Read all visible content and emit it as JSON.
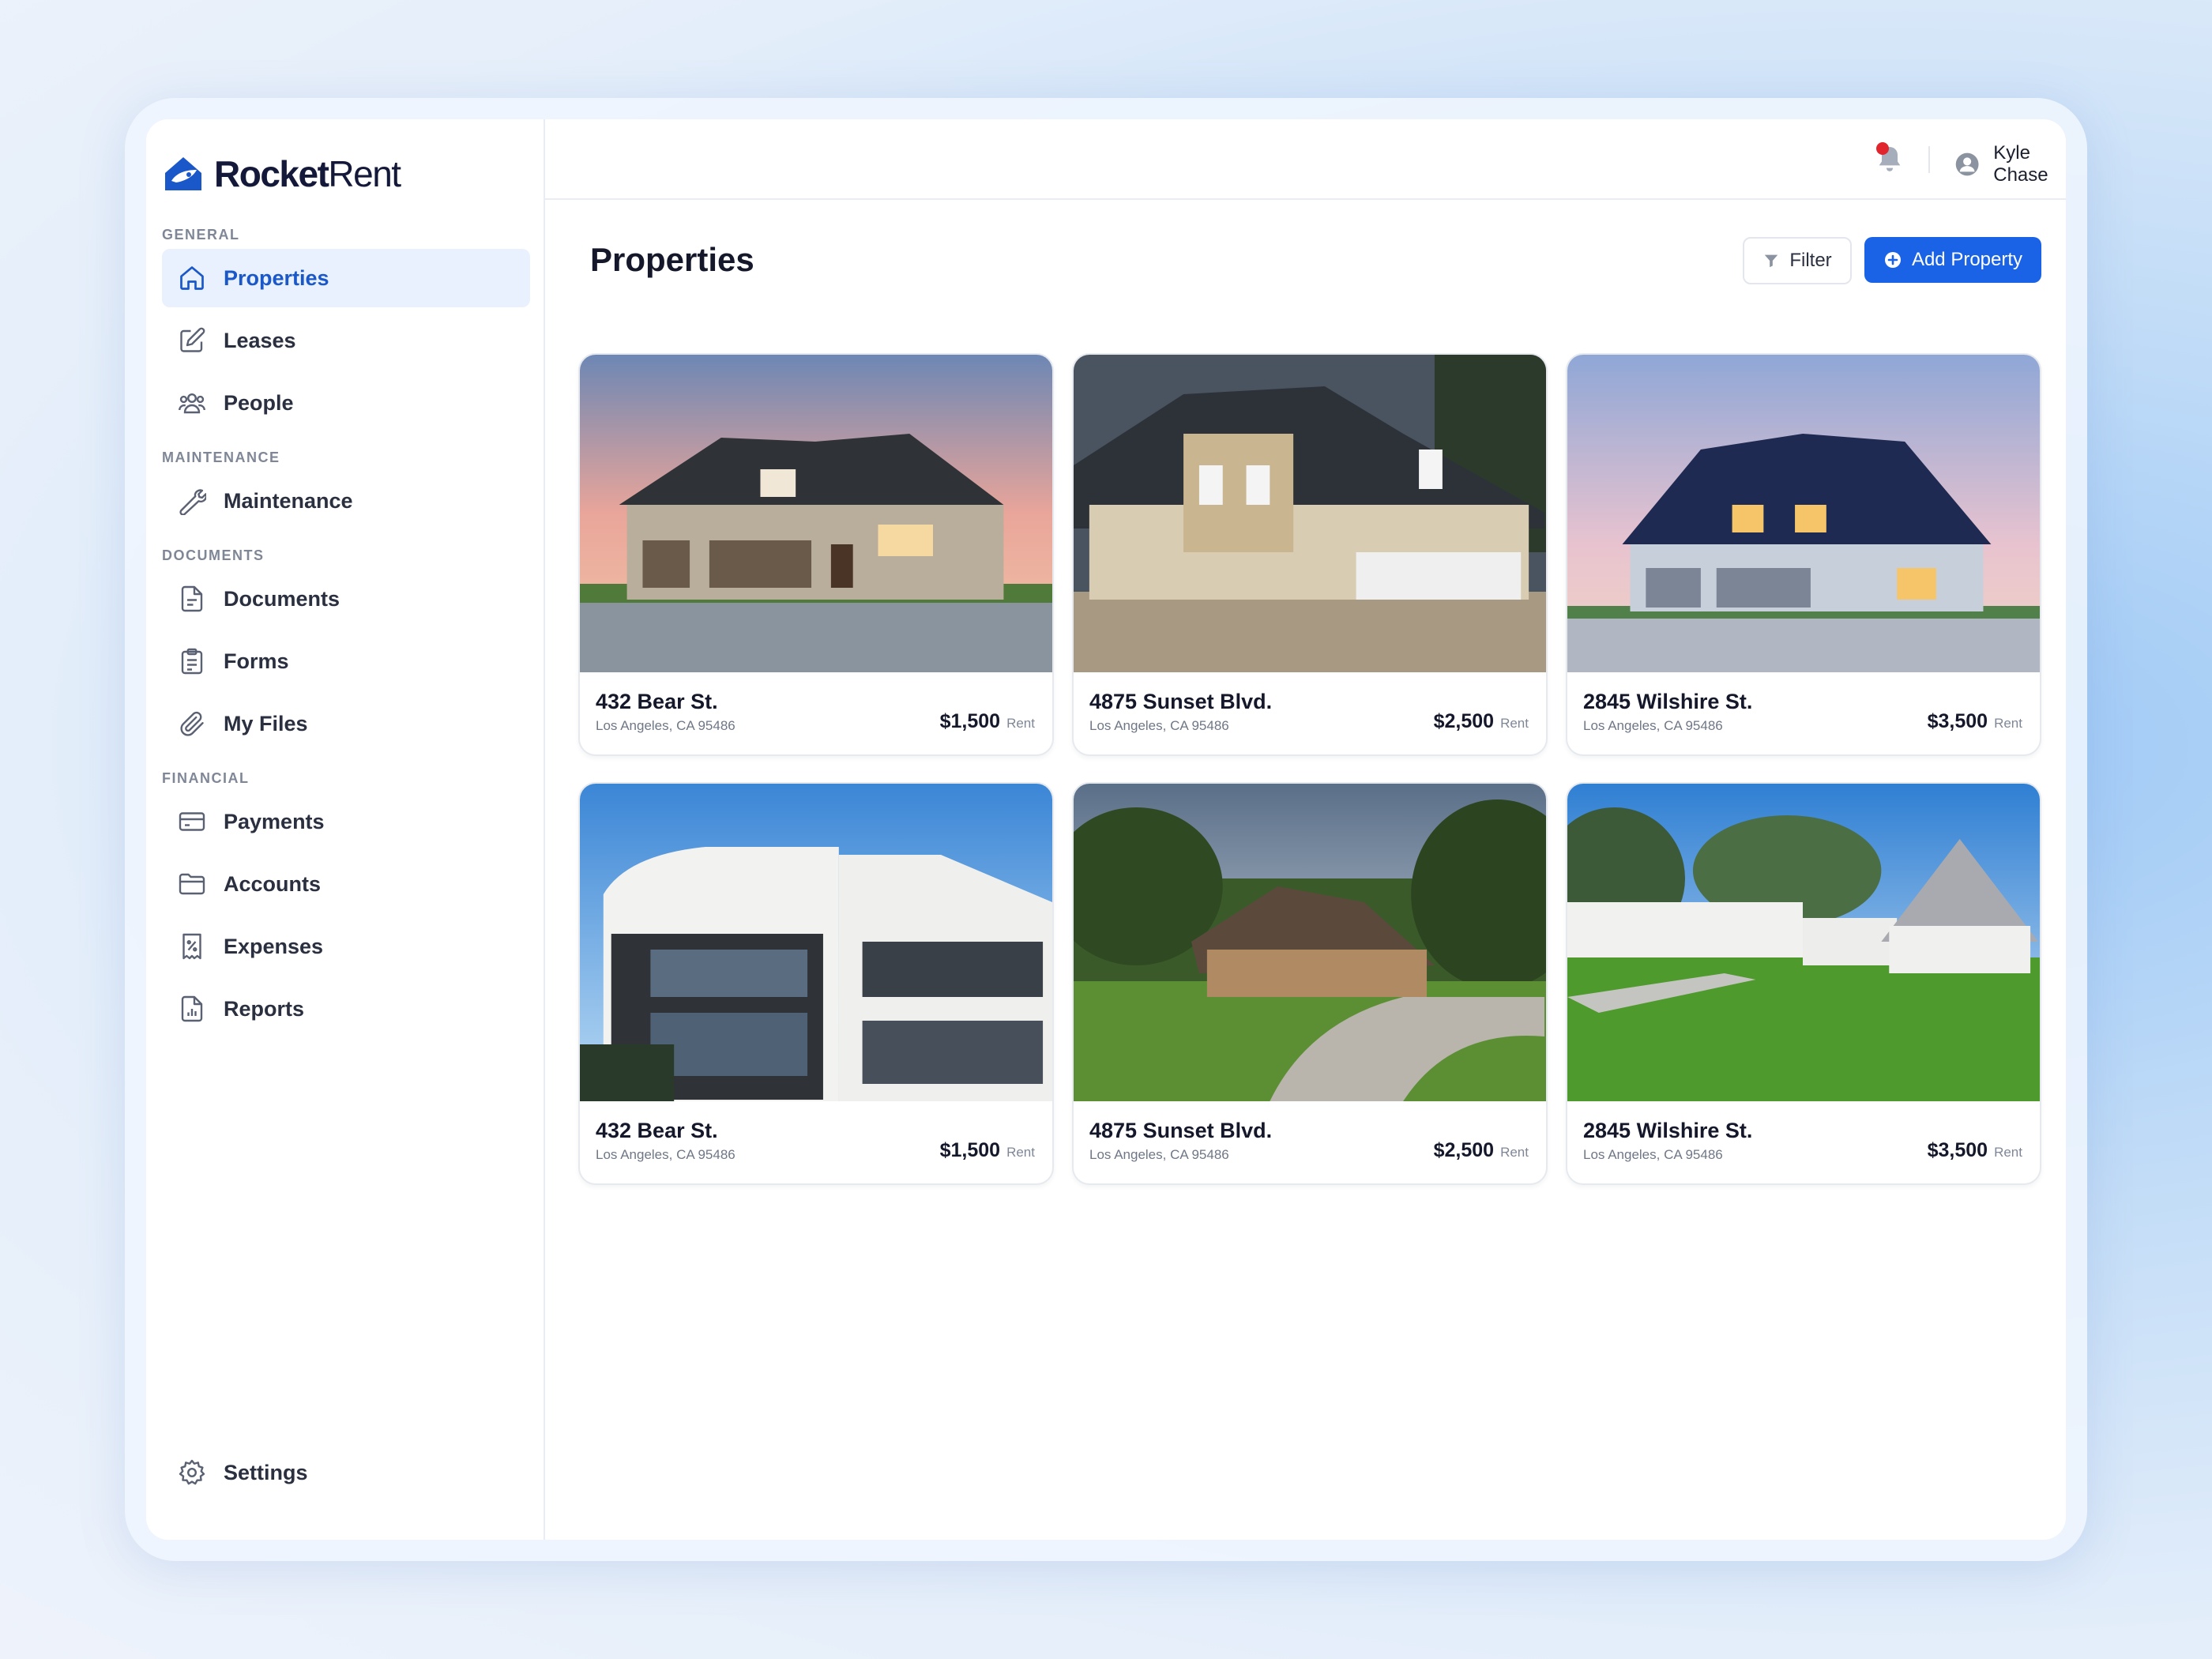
{
  "brand": {
    "name_bold": "Rocket",
    "name_light": "Rent",
    "accent": "#1a63e6"
  },
  "sidebar": {
    "sections": [
      {
        "label": "GENERAL",
        "items": [
          {
            "label": "Properties",
            "icon": "home-icon",
            "active": true
          },
          {
            "label": "Leases",
            "icon": "edit-icon"
          },
          {
            "label": "People",
            "icon": "people-icon"
          }
        ]
      },
      {
        "label": "MAINTENANCE",
        "items": [
          {
            "label": "Maintenance",
            "icon": "wrench-icon"
          }
        ]
      },
      {
        "label": "DOCUMENTS",
        "items": [
          {
            "label": "Documents",
            "icon": "document-icon"
          },
          {
            "label": "Forms",
            "icon": "clipboard-icon"
          },
          {
            "label": "My Files",
            "icon": "paperclip-icon"
          }
        ]
      },
      {
        "label": "FINANCIAL",
        "items": [
          {
            "label": "Payments",
            "icon": "credit-card-icon"
          },
          {
            "label": "Accounts",
            "icon": "folder-icon"
          },
          {
            "label": "Expenses",
            "icon": "receipt-icon"
          },
          {
            "label": "Reports",
            "icon": "report-icon"
          }
        ]
      }
    ],
    "settings_label": "Settings"
  },
  "header": {
    "user_name": "Kyle Chase",
    "notification_indicator": true
  },
  "page": {
    "title": "Properties",
    "filter_label": "Filter",
    "add_label": "Add Property"
  },
  "properties": [
    {
      "address": "432 Bear St.",
      "city": "Los Angeles, CA 95486",
      "price": "$1,500",
      "price_unit": "Rent"
    },
    {
      "address": "4875 Sunset Blvd.",
      "city": "Los Angeles, CA 95486",
      "price": "$2,500",
      "price_unit": "Rent"
    },
    {
      "address": "2845 Wilshire St.",
      "city": "Los Angeles, CA 95486",
      "price": "$3,500",
      "price_unit": "Rent"
    },
    {
      "address": "432 Bear St.",
      "city": "Los Angeles, CA 95486",
      "price": "$1,500",
      "price_unit": "Rent"
    },
    {
      "address": "4875 Sunset Blvd.",
      "city": "Los Angeles, CA 95486",
      "price": "$2,500",
      "price_unit": "Rent"
    },
    {
      "address": "2845 Wilshire St.",
      "city": "Los Angeles, CA 95486",
      "price": "$3,500",
      "price_unit": "Rent"
    }
  ]
}
